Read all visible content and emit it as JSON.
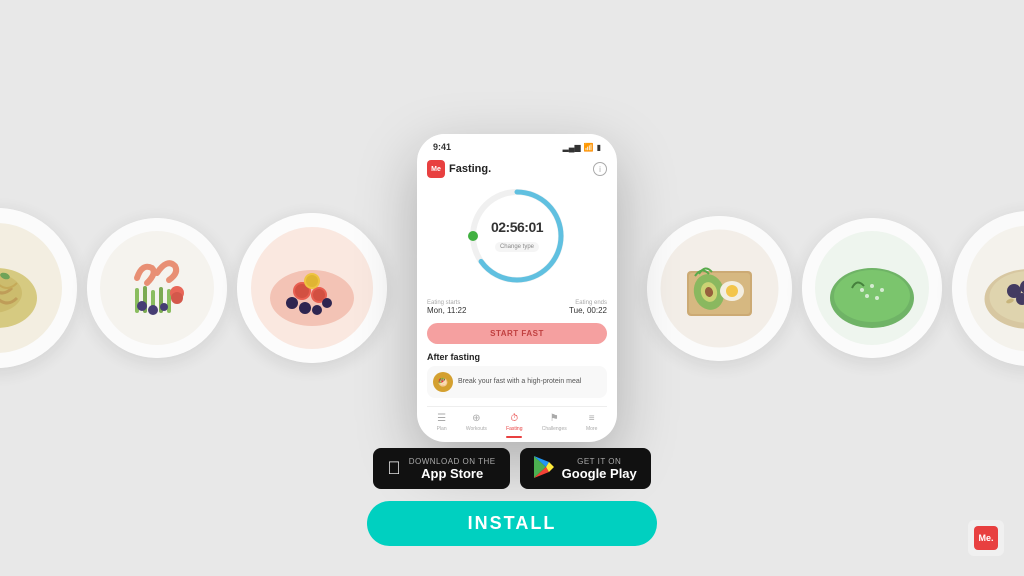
{
  "background_color": "#e8e8e8",
  "plates": [
    {
      "id": "pasta",
      "label": "Pasta dish",
      "color_center": "#c8b560",
      "color_mid": "#d4c070",
      "color_outer": "#e8d580"
    },
    {
      "id": "asparagus",
      "label": "Asparagus with shrimp",
      "color_center": "#7ab648",
      "color_outer": "#5a8a2a"
    },
    {
      "id": "pink",
      "label": "Pink berry dish",
      "color_center": "#f5a0a0",
      "color_outer": "#f0c0c0"
    },
    {
      "id": "avocado",
      "label": "Avocado toast",
      "color_center": "#8ab060",
      "color_outer": "#6a9040"
    },
    {
      "id": "green",
      "label": "Green smoothie bowl",
      "color_center": "#5aaa50",
      "color_outer": "#4a9040"
    },
    {
      "id": "oatmeal",
      "label": "Oatmeal with blueberries",
      "color_center": "#d0c090",
      "color_outer": "#c0a870"
    }
  ],
  "phone": {
    "status_bar": {
      "time": "9:41",
      "signal": "▂▄▆",
      "wifi": "WiFi",
      "battery": "🔋"
    },
    "app": {
      "logo_text": "Me",
      "app_name": "Fasting.",
      "timer": "02:56:01",
      "change_type_label": "Change type",
      "eating_starts_label": "Eating starts",
      "eating_starts_value": "Mon, 11:22",
      "eating_ends_label": "Eating ends",
      "eating_ends_value": "Tue, 00:22",
      "start_fast_label": "START FAST",
      "after_fasting_title": "After fasting",
      "after_fasting_desc": "Break your fast with a high-protein meal",
      "tabs": [
        {
          "id": "plan",
          "label": "Plan",
          "active": false
        },
        {
          "id": "workouts",
          "label": "Workouts",
          "active": false
        },
        {
          "id": "fasting",
          "label": "Fasting",
          "active": true
        },
        {
          "id": "challenges",
          "label": "Challenges",
          "active": false
        },
        {
          "id": "more",
          "label": "More",
          "active": false
        }
      ]
    }
  },
  "store_buttons": {
    "apple": {
      "sub_label": "Download on the",
      "main_label": "App Store"
    },
    "google": {
      "sub_label": "GET IT ON",
      "main_label": "Google Play"
    }
  },
  "install_button": {
    "label": "INSTALL"
  },
  "watermark": {
    "text": "Me."
  }
}
